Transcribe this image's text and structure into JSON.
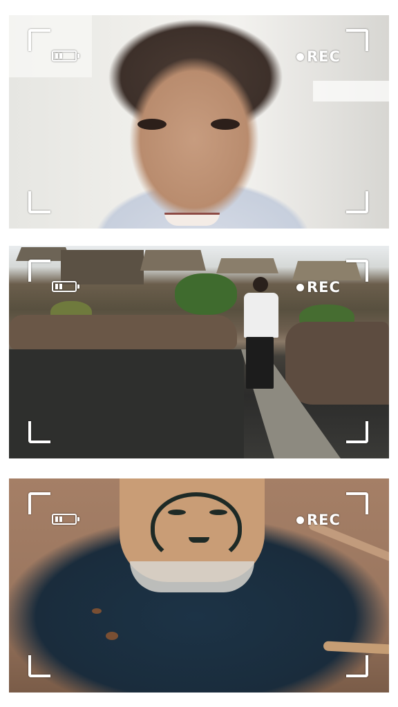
{
  "frames": [
    {
      "id": "selfie",
      "rec_label": "REC",
      "battery_level": 0.4
    },
    {
      "id": "river-walk",
      "rec_label": "REC",
      "battery_level": 0.4
    },
    {
      "id": "coffee-cup",
      "rec_label": "REC",
      "battery_level": 0.4
    }
  ],
  "colors": {
    "overlay": "#ffffff",
    "background": "#ffffff"
  }
}
